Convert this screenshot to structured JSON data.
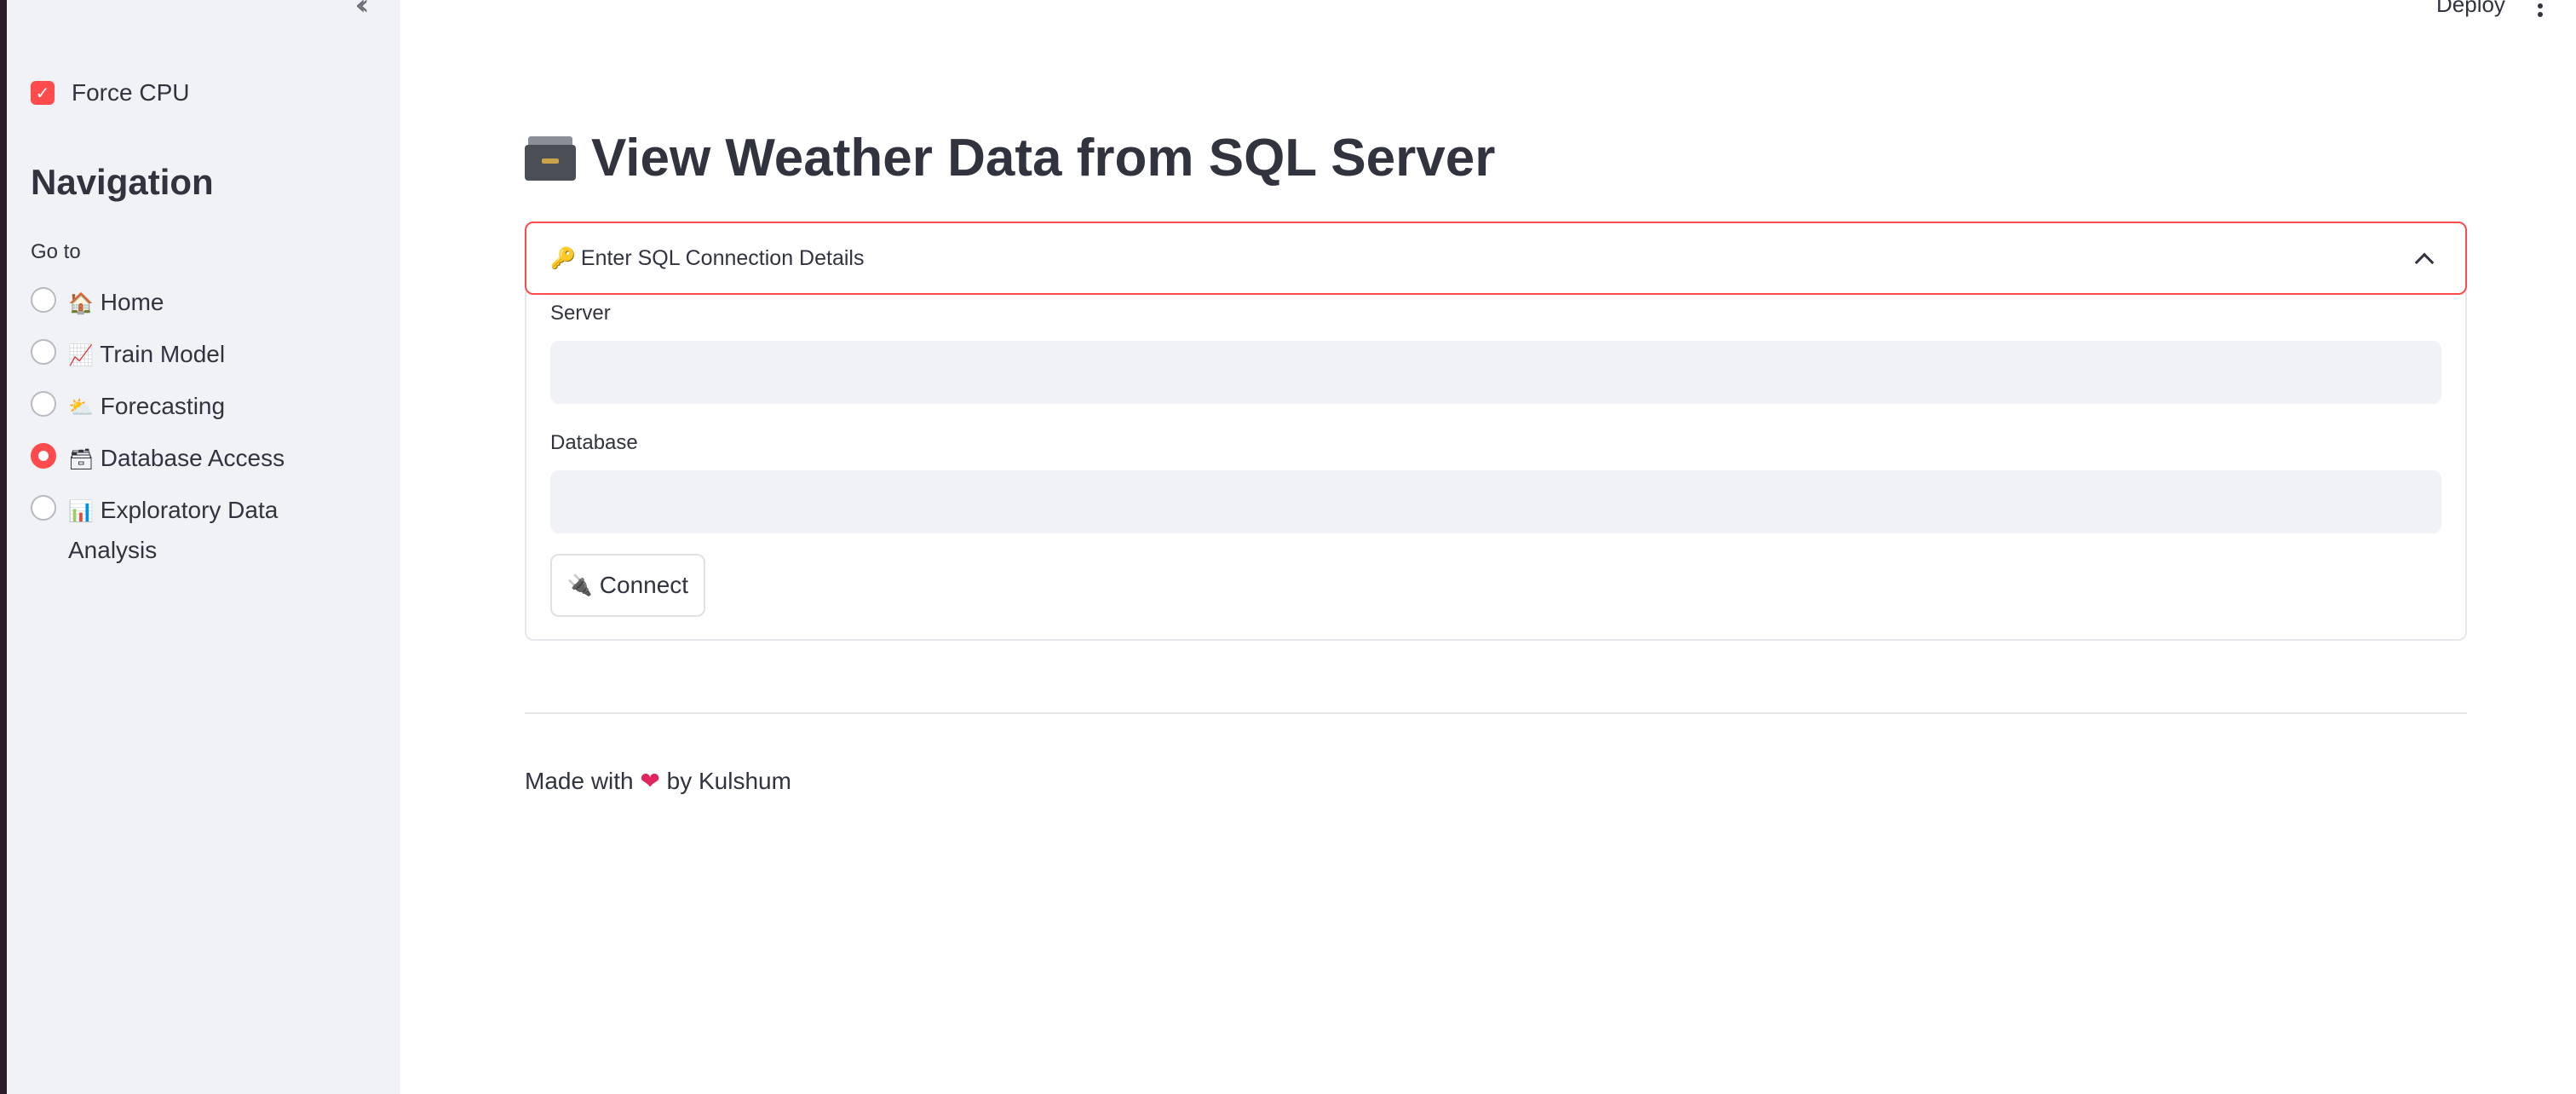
{
  "sidebar": {
    "collapse_icon": "double-chevron-left-icon",
    "force_cpu": {
      "label": "Force CPU",
      "checked": true
    },
    "nav_title": "Navigation",
    "goto_label": "Go to",
    "items": [
      {
        "emoji": "🏠",
        "label": "Home",
        "selected": false
      },
      {
        "emoji": "📈",
        "label": "Train Model",
        "selected": false
      },
      {
        "emoji": "⛅",
        "label": "Forecasting",
        "selected": false
      },
      {
        "emoji": "🗃",
        "label": "Database Access",
        "selected": true
      },
      {
        "emoji": "📊",
        "label": "Exploratory Data Analysis",
        "selected": false
      }
    ]
  },
  "header": {
    "deploy_label": "Deploy",
    "menu_icon": "kebab-menu-icon"
  },
  "main": {
    "title": "View Weather Data from SQL Server",
    "title_icon": "file-cabinet-icon",
    "expander": {
      "icon": "🔑",
      "title": "Enter SQL Connection Details",
      "expanded": true,
      "server_label": "Server",
      "server_value": "",
      "database_label": "Database",
      "database_value": "",
      "connect_icon": "🔌",
      "connect_label": "Connect"
    },
    "footer": {
      "prefix": "Made with",
      "heart": "❤",
      "suffix": "by Kulshum"
    }
  },
  "colors": {
    "accent": "#ff4b4b",
    "sidebar_bg": "#f0f2f6",
    "text": "#31333f"
  }
}
